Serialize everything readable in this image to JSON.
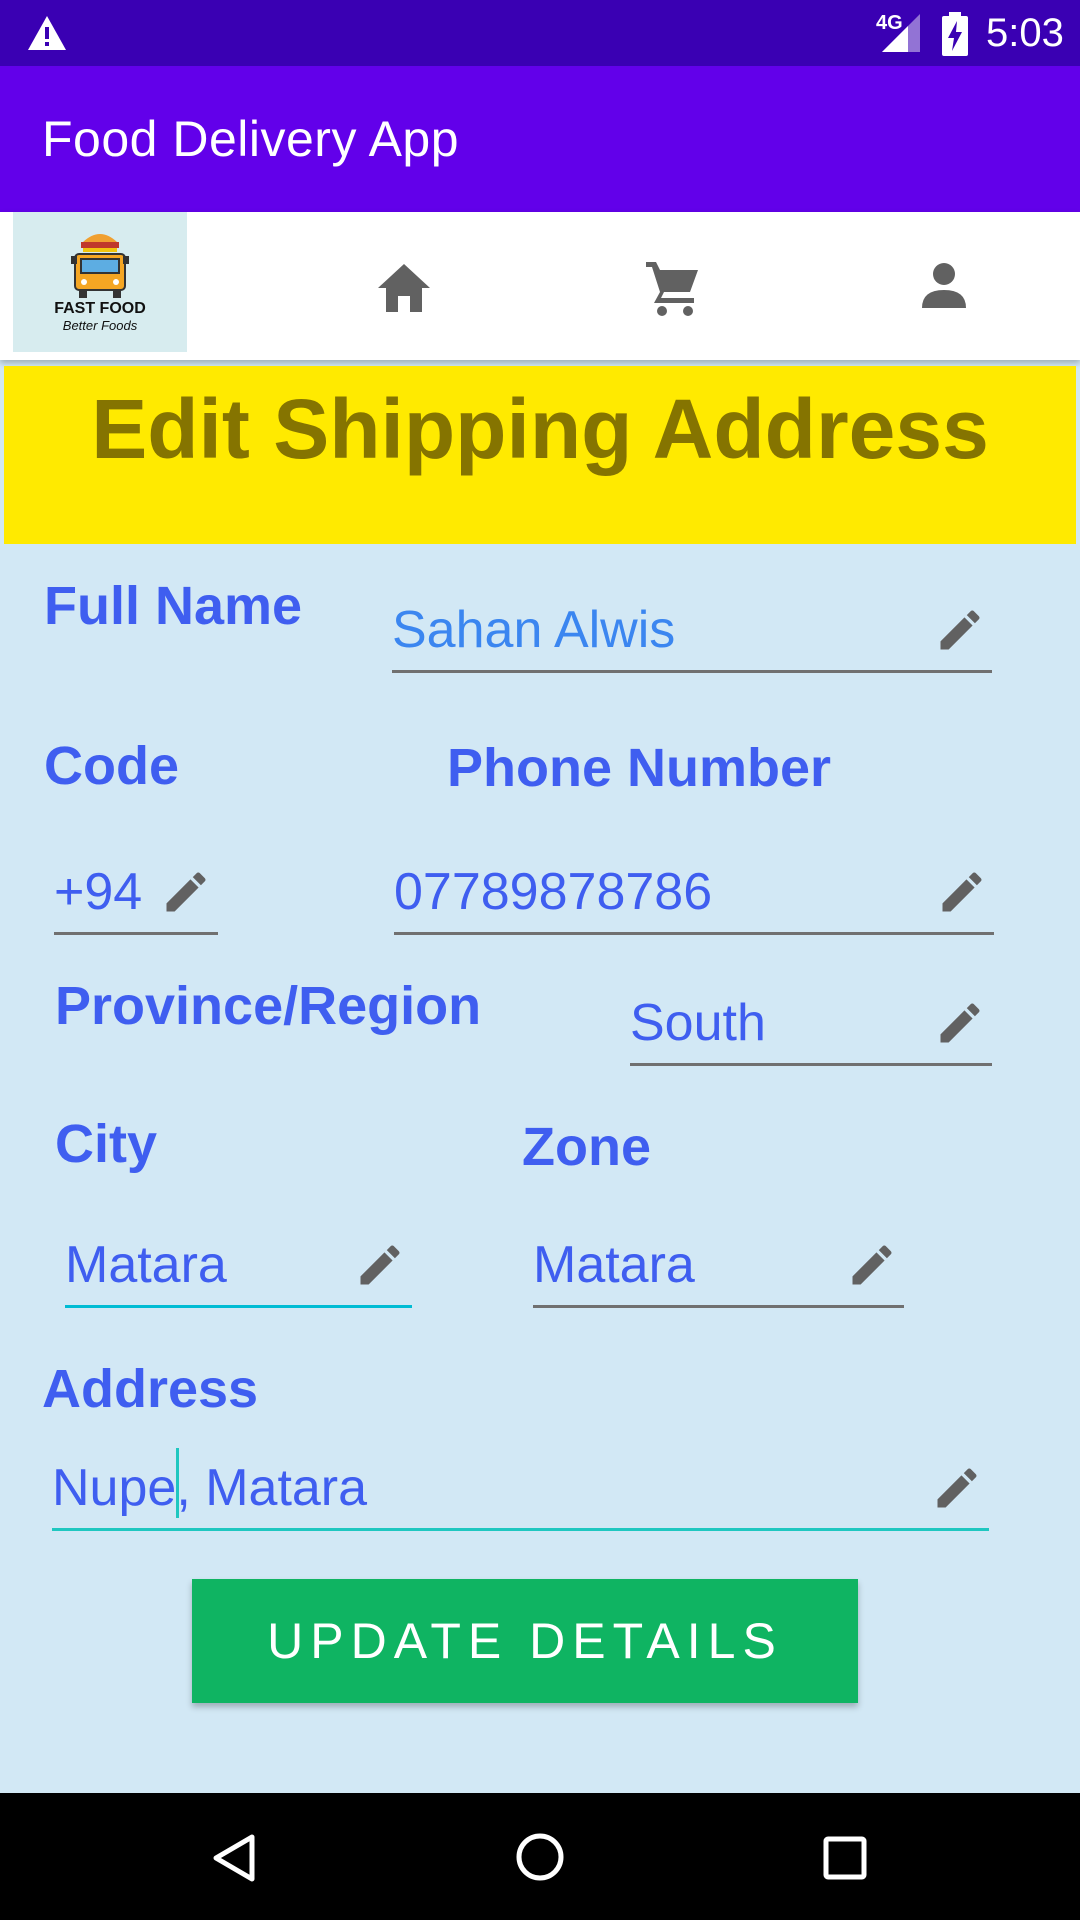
{
  "status_bar": {
    "time": "5:03",
    "network": "4G",
    "icons": [
      "warning-icon",
      "signal-icon",
      "battery-icon"
    ]
  },
  "app_bar": {
    "title": "Food Delivery App"
  },
  "nav": {
    "logo_line1": "FAST FOOD",
    "logo_line2": "Better Foods",
    "items": [
      "home-icon",
      "cart-icon",
      "profile-icon"
    ]
  },
  "header": {
    "title": "Edit Shipping Address"
  },
  "form": {
    "full_name": {
      "label": "Full Name",
      "value": "Sahan Alwis"
    },
    "code": {
      "label": "Code",
      "value": "+94"
    },
    "phone": {
      "label": "Phone Number",
      "value": "07789878786"
    },
    "province": {
      "label": "Province/Region",
      "value": "South"
    },
    "city": {
      "label": "City",
      "value": "Matara"
    },
    "zone": {
      "label": "Zone",
      "value": "Matara"
    },
    "address": {
      "label": "Address",
      "value": "Nupe, Matara"
    }
  },
  "update_button": {
    "label": "UPDATE DETAILS"
  },
  "colors": {
    "status": "#3a00b3",
    "app_bar": "#6200ea",
    "banner": "#ffea00",
    "label": "#3f5ef0",
    "button": "#0fb462",
    "background": "#d2e8f5"
  }
}
